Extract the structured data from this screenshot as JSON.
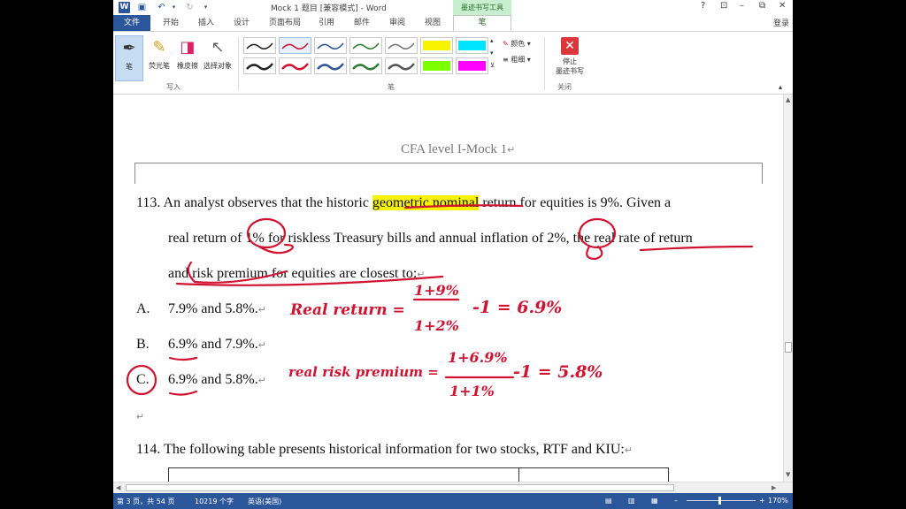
{
  "titlebar": {
    "title": "Mock 1 题目 [兼容模式] - Word",
    "ink_tools_tab": "墨迹书写工具",
    "help": "?",
    "restore": "⊡",
    "minimize": "–",
    "maximize": "⧉",
    "close": "✕"
  },
  "tabs": {
    "file": "文件",
    "home": "开始",
    "insert": "插入",
    "design": "设计",
    "layout": "页面布局",
    "references": "引用",
    "mailings": "邮件",
    "review": "审阅",
    "view": "视图",
    "pen": "笔",
    "login": "登录"
  },
  "ribbon": {
    "pen": "笔",
    "highlighter": "荧光笔",
    "eraser": "橡皮擦",
    "select_objects": "选择对象",
    "group_write": "写入",
    "group_pens": "笔",
    "color": "颜色",
    "thickness": "粗细",
    "stop_ink": "停止\n墨迹书写",
    "group_close": "关闭",
    "colors": {
      "highlight_yellow": "#f7f200",
      "highlight_cyan": "#00e5ff",
      "highlight_green": "#7cff00",
      "highlight_magenta": "#ff00ff",
      "ink_red": "#d01330",
      "stop_red": "#d9373b"
    }
  },
  "document": {
    "header_title": "CFA level I-Mock 1",
    "q113": {
      "line1_pre": "113. An analyst observes that the historic ",
      "line1_hl": "geometric nominal",
      "line1_post": " return for equities is 9%. Given a",
      "line2": "real return of 1% for riskless Treasury bills and annual inflation of 2%, the real rate of return",
      "line3": "and risk premium for equities are closest to:",
      "option_a_label": "A.",
      "option_a": "7.9% and 5.8%.",
      "option_b_label": "B.",
      "option_b": "6.9% and 7.9%.",
      "option_c_label": "C.",
      "option_c": "6.9% and 5.8%."
    },
    "q114": {
      "line1": "114. The following table presents historical information for two stocks, RTF and KIU:"
    },
    "ink": {
      "real_return_label": "Real return =",
      "real_return_num": "1+9%",
      "real_return_den": "1+2%",
      "real_return_tail": "-1 = 6.9%",
      "risk_premium_label": "real risk premium =",
      "risk_premium_num": "1+6.9%",
      "risk_premium_den": "1+1%",
      "risk_premium_tail": "-1 = 5.8%"
    }
  },
  "status": {
    "page": "第 3 页，共 54 页",
    "words": "10219 个字",
    "language": "英语(美国)",
    "zoom": "170%"
  }
}
